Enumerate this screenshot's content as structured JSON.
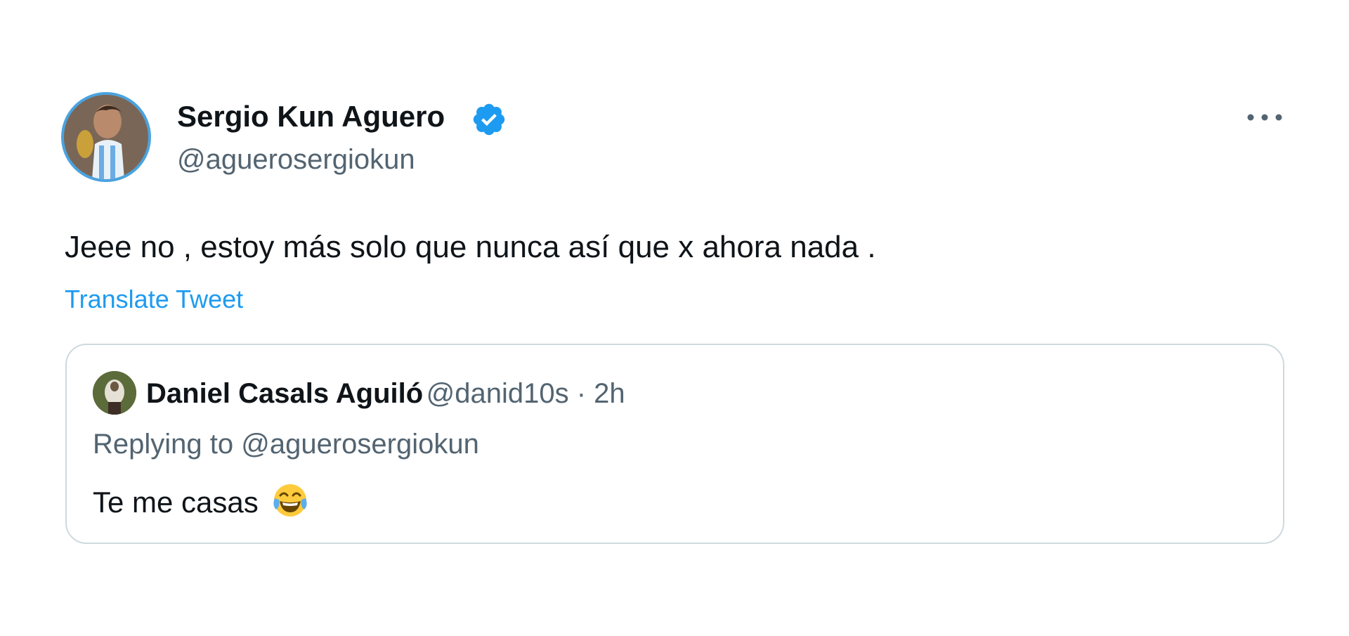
{
  "tweet": {
    "author": {
      "display_name": "Sergio Kun Aguero",
      "handle": "@aguerosergiokun",
      "verified": true
    },
    "text": "Jeee no , estoy más solo que nunca así que x ahora nada .",
    "translate_label": "Translate Tweet",
    "more_menu_icon": "more-dots-icon"
  },
  "quoted": {
    "display_name": "Daniel Casals Aguiló",
    "handle": "@danid10s",
    "separator": " · ",
    "time": "2h",
    "replying_prefix": "Replying to ",
    "replying_to": "@aguerosergiokun",
    "text": "Te me casas",
    "emoji": "face-with-tears-of-joy"
  },
  "colors": {
    "link": "#1d9bf0",
    "secondary_text": "#536471",
    "verified_badge": "#1d9bf0",
    "card_border": "#cfd9de"
  }
}
